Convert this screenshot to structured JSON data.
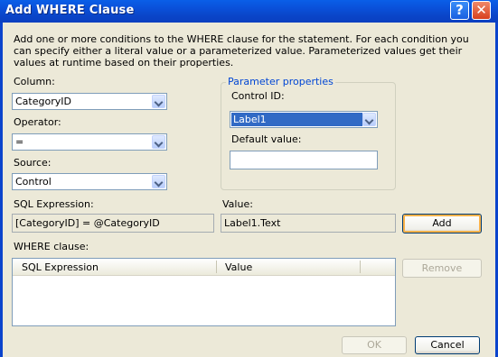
{
  "window": {
    "title": "Add WHERE Clause",
    "help_glyph": "?",
    "close_glyph": "✕"
  },
  "description": "Add one or more conditions to the WHERE clause for the statement. For each condition you can specify either a literal value or a parameterized value. Parameterized values get their values at runtime based on their properties.",
  "column": {
    "label": "Column:",
    "value": "CategoryID"
  },
  "operator": {
    "label": "Operator:",
    "value": "="
  },
  "source": {
    "label": "Source:",
    "value": "Control"
  },
  "parameter_properties": {
    "title": "Parameter properties",
    "control_id_label": "Control ID:",
    "control_id_value": "Label1",
    "default_value_label": "Default value:",
    "default_value": ""
  },
  "sql_expression": {
    "label": "SQL Expression:",
    "value": "[CategoryID] = @CategoryID"
  },
  "value": {
    "label": "Value:",
    "value": "Label1.Text"
  },
  "buttons": {
    "add": "Add",
    "remove": "Remove",
    "ok": "OK",
    "cancel": "Cancel"
  },
  "where_clause": {
    "label": "WHERE clause:",
    "columns": [
      "SQL Expression",
      "Value"
    ],
    "rows": []
  },
  "colors": {
    "titlebar": "#0a4fd8",
    "highlight": "#316ac5",
    "group_title": "#0046d5",
    "background": "#ece9d8"
  }
}
